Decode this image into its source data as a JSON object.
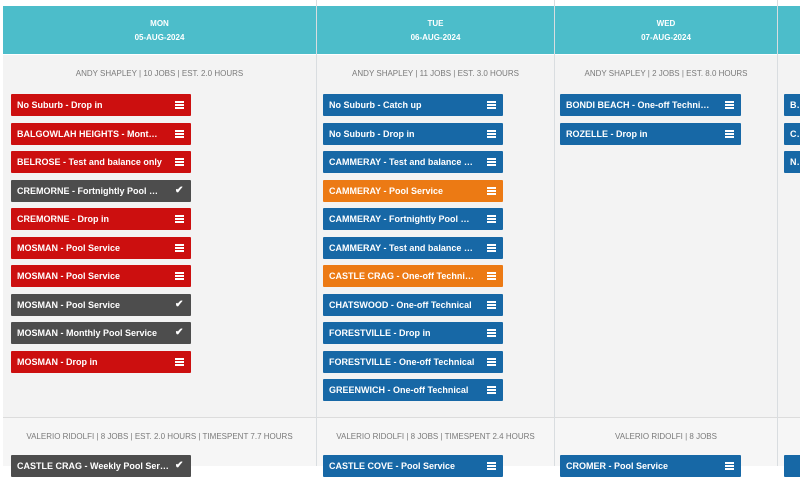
{
  "days": [
    {
      "day": "MON",
      "date": "05-AUG-2024",
      "tech": "ANDY SHAPLEY | 10 JOBS | EST. 2.0 HOURS",
      "jobs": [
        {
          "label": "No Suburb - Drop in",
          "color": "#cc0f0f",
          "icon": "menu-icon"
        },
        {
          "label": "BALGOWLAH HEIGHTS - Mont…",
          "color": "#cc0f0f",
          "icon": "menu-icon"
        },
        {
          "label": "BELROSE - Test and balance only",
          "color": "#cc0f0f",
          "icon": "menu-icon"
        },
        {
          "label": "CREMORNE - Fortnightly Pool …",
          "color": "#4d4d4d",
          "icon": "check-icon"
        },
        {
          "label": "CREMORNE - Drop in",
          "color": "#cc0f0f",
          "icon": "menu-icon"
        },
        {
          "label": "MOSMAN - Pool Service",
          "color": "#cc0f0f",
          "icon": "menu-icon"
        },
        {
          "label": "MOSMAN - Pool Service",
          "color": "#cc0f0f",
          "icon": "menu-icon"
        },
        {
          "label": "MOSMAN - Pool Service",
          "color": "#4d4d4d",
          "icon": "check-icon"
        },
        {
          "label": "MOSMAN - Monthly Pool Service",
          "color": "#4d4d4d",
          "icon": "check-icon"
        },
        {
          "label": "MOSMAN - Drop in",
          "color": "#cc0f0f",
          "icon": "menu-icon"
        }
      ],
      "tech2": "VALERIO RIDOLFI | 8 JOBS | EST. 2.0 HOURS | TIMESPENT 7.7 HOURS",
      "job2": {
        "label": "CASTLE CRAG - Weekly Pool Service",
        "color": "#4d4d4d",
        "icon": "check-icon"
      }
    },
    {
      "day": "TUE",
      "date": "06-AUG-2024",
      "tech": "ANDY SHAPLEY | 11 JOBS | EST. 3.0 HOURS",
      "jobs": [
        {
          "label": "No Suburb - Catch up",
          "color": "#1768a6",
          "icon": "menu-icon"
        },
        {
          "label": "No Suburb - Drop in",
          "color": "#1768a6",
          "icon": "menu-icon"
        },
        {
          "label": "CAMMERAY - Test and balance …",
          "color": "#1768a6",
          "icon": "menu-icon"
        },
        {
          "label": "CAMMERAY - Pool Service",
          "color": "#ec7a14",
          "icon": "menu-icon"
        },
        {
          "label": "CAMMERAY - Fortnightly Pool …",
          "color": "#1768a6",
          "icon": "menu-icon"
        },
        {
          "label": "CAMMERAY - Test and balance …",
          "color": "#1768a6",
          "icon": "menu-icon"
        },
        {
          "label": "CASTLE CRAG - One-off Techni…",
          "color": "#ec7a14",
          "icon": "menu-icon"
        },
        {
          "label": "CHATSWOOD - One-off Technical",
          "color": "#1768a6",
          "icon": "menu-icon"
        },
        {
          "label": "FORESTVILLE - Drop in",
          "color": "#1768a6",
          "icon": "menu-icon"
        },
        {
          "label": "FORESTVILLE - One-off Technical",
          "color": "#1768a6",
          "icon": "menu-icon"
        },
        {
          "label": "GREENWICH - One-off Technical",
          "color": "#1768a6",
          "icon": "menu-icon"
        }
      ],
      "tech2": "VALERIO RIDOLFI | 8 JOBS | TIMESPENT 2.4 HOURS",
      "job2": {
        "label": "CASTLE COVE - Pool Service",
        "color": "#1768a6",
        "icon": "menu-icon"
      }
    },
    {
      "day": "WED",
      "date": "07-AUG-2024",
      "tech": "ANDY SHAPLEY | 2 JOBS | EST. 8.0 HOURS",
      "jobs": [
        {
          "label": "BONDI BEACH - One-off Techni…",
          "color": "#1768a6",
          "icon": "menu-icon"
        },
        {
          "label": "ROZELLE - Drop in",
          "color": "#1768a6",
          "icon": "menu-icon"
        }
      ],
      "tech2": "VALERIO RIDOLFI | 8 JOBS",
      "job2": {
        "label": "CROMER - Pool Service",
        "color": "#1768a6",
        "icon": "menu-icon"
      }
    },
    {
      "day": "",
      "date": "",
      "tech": "",
      "jobs": [
        {
          "label": "BO",
          "color": "#1768a6",
          "icon": "menu-icon"
        },
        {
          "label": "CO",
          "color": "#1768a6",
          "icon": "menu-icon"
        },
        {
          "label": "NO",
          "color": "#1768a6",
          "icon": "menu-icon"
        }
      ],
      "tech2": "",
      "job2": {
        "label": "",
        "color": "#1768a6",
        "icon": "menu-icon"
      }
    }
  ]
}
